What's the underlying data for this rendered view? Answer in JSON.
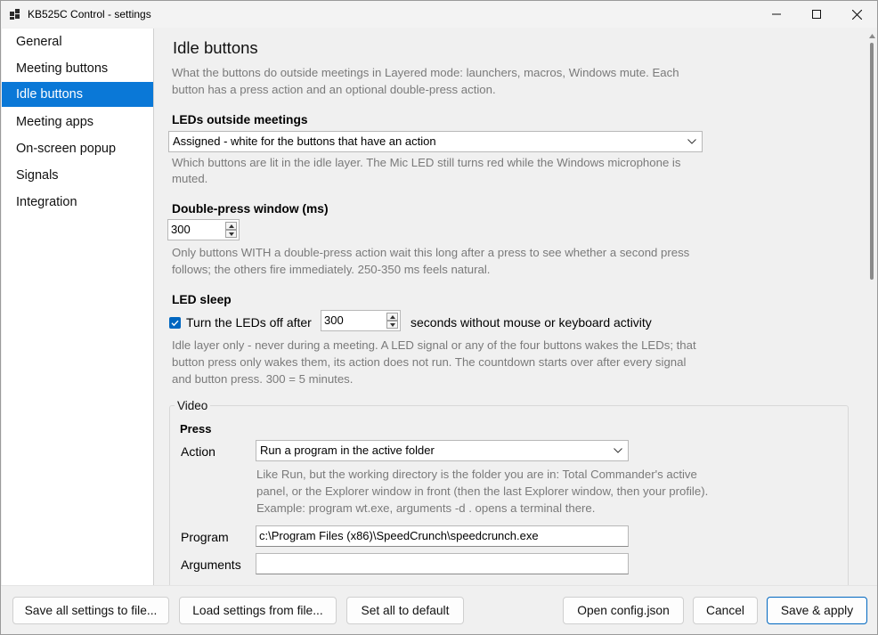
{
  "window": {
    "title": "KB525C Control - settings"
  },
  "sidebar": {
    "items": [
      {
        "label": "General"
      },
      {
        "label": "Meeting buttons"
      },
      {
        "label": "Idle buttons",
        "selected": true
      },
      {
        "label": "Meeting apps"
      },
      {
        "label": "On-screen popup"
      },
      {
        "label": "Signals"
      },
      {
        "label": "Integration"
      }
    ]
  },
  "page": {
    "title": "Idle buttons",
    "description_line1": "What the buttons do outside meetings in Layered mode: launchers, macros, Windows mute. Each",
    "description_line2": "button has a press action and an optional double-press action."
  },
  "leds": {
    "label": "LEDs outside meetings",
    "selected": "Assigned - white for the buttons that have an action",
    "help_line1": "Which buttons are lit in the idle layer. The Mic LED still turns red while the Windows microphone is",
    "help_line2": "muted."
  },
  "double_press": {
    "label": "Double-press window (ms)",
    "value": "300",
    "help_line1": "Only buttons WITH a double-press action wait this long after a press to see whether a second press",
    "help_line2": "follows; the others fire immediately. 250-350 ms feels natural."
  },
  "led_sleep": {
    "label": "LED sleep",
    "checkbox_label": "Turn the LEDs off after",
    "checked": true,
    "value": "300",
    "suffix": "seconds without mouse or keyboard activity",
    "help_line1": "Idle layer only - never during a meeting. A LED signal or any of the four buttons wakes the LEDs; that",
    "help_line2": "button press only wakes them, its action does not run. The countdown starts over after every signal",
    "help_line3": "and button press. 300 = 5 minutes."
  },
  "video": {
    "group_title": "Video",
    "press_label": "Press",
    "action_label": "Action",
    "action_selected": "Run a program in the active folder",
    "action_help_line1": "Like Run, but the working directory is the folder you are in: Total Commander's active",
    "action_help_line2": "panel, or the Explorer window in front (then the last Explorer window, then your profile).",
    "action_help_line3": "Example: program wt.exe, arguments -d .  opens a terminal there.",
    "program_label": "Program",
    "program_value": "c:\\Program Files (x86)\\SpeedCrunch\\speedcrunch.exe",
    "arguments_label": "Arguments",
    "arguments_value": ""
  },
  "footer": {
    "save_all": "Save all settings to file...",
    "load": "Load settings from file...",
    "defaults": "Set all to default",
    "open_config": "Open config.json",
    "cancel": "Cancel",
    "save_apply": "Save & apply"
  },
  "colors": {
    "accent": "#0067c0",
    "selection": "#0a78d7",
    "help_text": "#7a7a7a"
  }
}
